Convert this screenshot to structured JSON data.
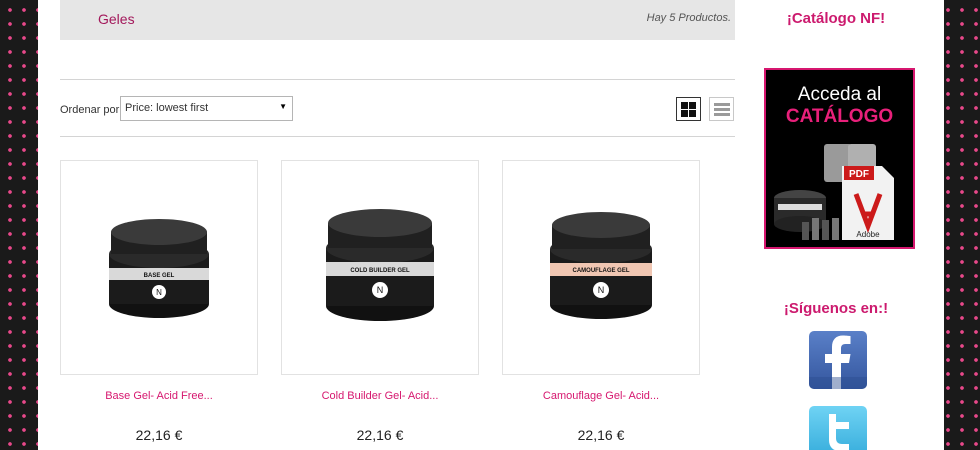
{
  "category": {
    "name": "Geles",
    "count_text": "Hay 5 Productos."
  },
  "sort": {
    "label": "Ordenar por",
    "selected": "Price: lowest first"
  },
  "view": {
    "grid_icon": "grid-view-icon",
    "list_icon": "list-view-icon"
  },
  "products": [
    {
      "name": "Base Gel- Acid Free...",
      "price": "22,16 €",
      "jar_label": "BASE GEL",
      "band_color": "#d9d9d9"
    },
    {
      "name": "Cold Builder Gel- Acid...",
      "price": "22,16 €",
      "jar_label": "COLD BUILDER GEL",
      "band_color": "#d9d9d9"
    },
    {
      "name": "Camouflage Gel- Acid...",
      "price": "22,16 €",
      "jar_label": "CAMOUFLAGE GEL",
      "band_color": "#f0c6b2"
    }
  ],
  "sidebar": {
    "catalog_title": "¡Catálogo NF!",
    "banner": {
      "line1": "Acceda al",
      "line2": "CATÁLOGO",
      "pdf_label": "PDF",
      "adobe_label": "Adobe"
    },
    "follow_title": "¡Síguenos en:!",
    "social": [
      "facebook-icon",
      "twitter-icon"
    ]
  },
  "colors": {
    "accent": "#d6176f",
    "dots": "#e8488a",
    "background": "#1a1a1a"
  }
}
